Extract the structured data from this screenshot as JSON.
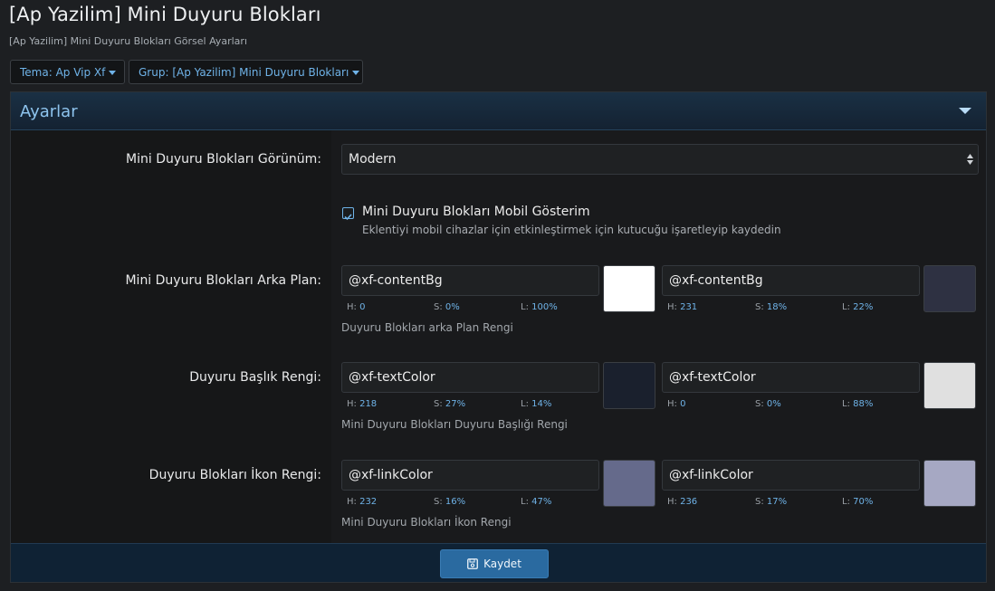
{
  "header": {
    "title": "[Ap Yazilim] Mini Duyuru Blokları",
    "subtitle": "[Ap Yazilim] Mini Duyuru Blokları Görsel Ayarları"
  },
  "filters": {
    "theme_label": "Tema: Ap Vip Xf",
    "group_label": "Grup: [Ap Yazilim] Mini Duyuru Blokları"
  },
  "block": {
    "title": "Ayarlar"
  },
  "settings": {
    "appearance": {
      "label": "Mini Duyuru Blokları Görünüm:",
      "selected": "Modern"
    },
    "mobile": {
      "label": "Mini Duyuru Blokları Mobil Gösterim",
      "hint": "Eklentiyi mobil cihazlar için etkinleştirmek için kutucuğu işaretleyip kaydedin",
      "checked": true
    },
    "background": {
      "label": "Mini Duyuru Blokları Arka Plan:",
      "hint": "Duyuru Blokları arka Plan Rengi",
      "light": {
        "value": "@xf-contentBg",
        "h": "0",
        "s": "0%",
        "l": "100%",
        "swatch": "#ffffff"
      },
      "dark": {
        "value": "@xf-contentBg",
        "h": "231",
        "s": "18%",
        "l": "22%",
        "swatch": "#2e3142"
      }
    },
    "title_color": {
      "label": "Duyuru Başlık Rengi:",
      "hint": "Mini Duyuru Blokları Duyuru Başlığı Rengi",
      "light": {
        "value": "@xf-textColor",
        "h": "218",
        "s": "27%",
        "l": "14%",
        "swatch": "#1a202d"
      },
      "dark": {
        "value": "@xf-textColor",
        "h": "0",
        "s": "0%",
        "l": "88%",
        "swatch": "#e0e0e0"
      }
    },
    "icon_color": {
      "label": "Duyuru Blokları İkon Rengi:",
      "hint": "Mini Duyuru Blokları İkon Rengi",
      "light": {
        "value": "@xf-linkColor",
        "h": "232",
        "s": "16%",
        "l": "47%",
        "swatch": "#656a8b"
      },
      "dark": {
        "value": "@xf-linkColor",
        "h": "236",
        "s": "17%",
        "l": "70%",
        "swatch": "#a6a8c3"
      }
    }
  },
  "footer": {
    "save_label": "Kaydet"
  },
  "hsl_labels": {
    "h": "H:",
    "s": "S:",
    "l": "L:"
  }
}
